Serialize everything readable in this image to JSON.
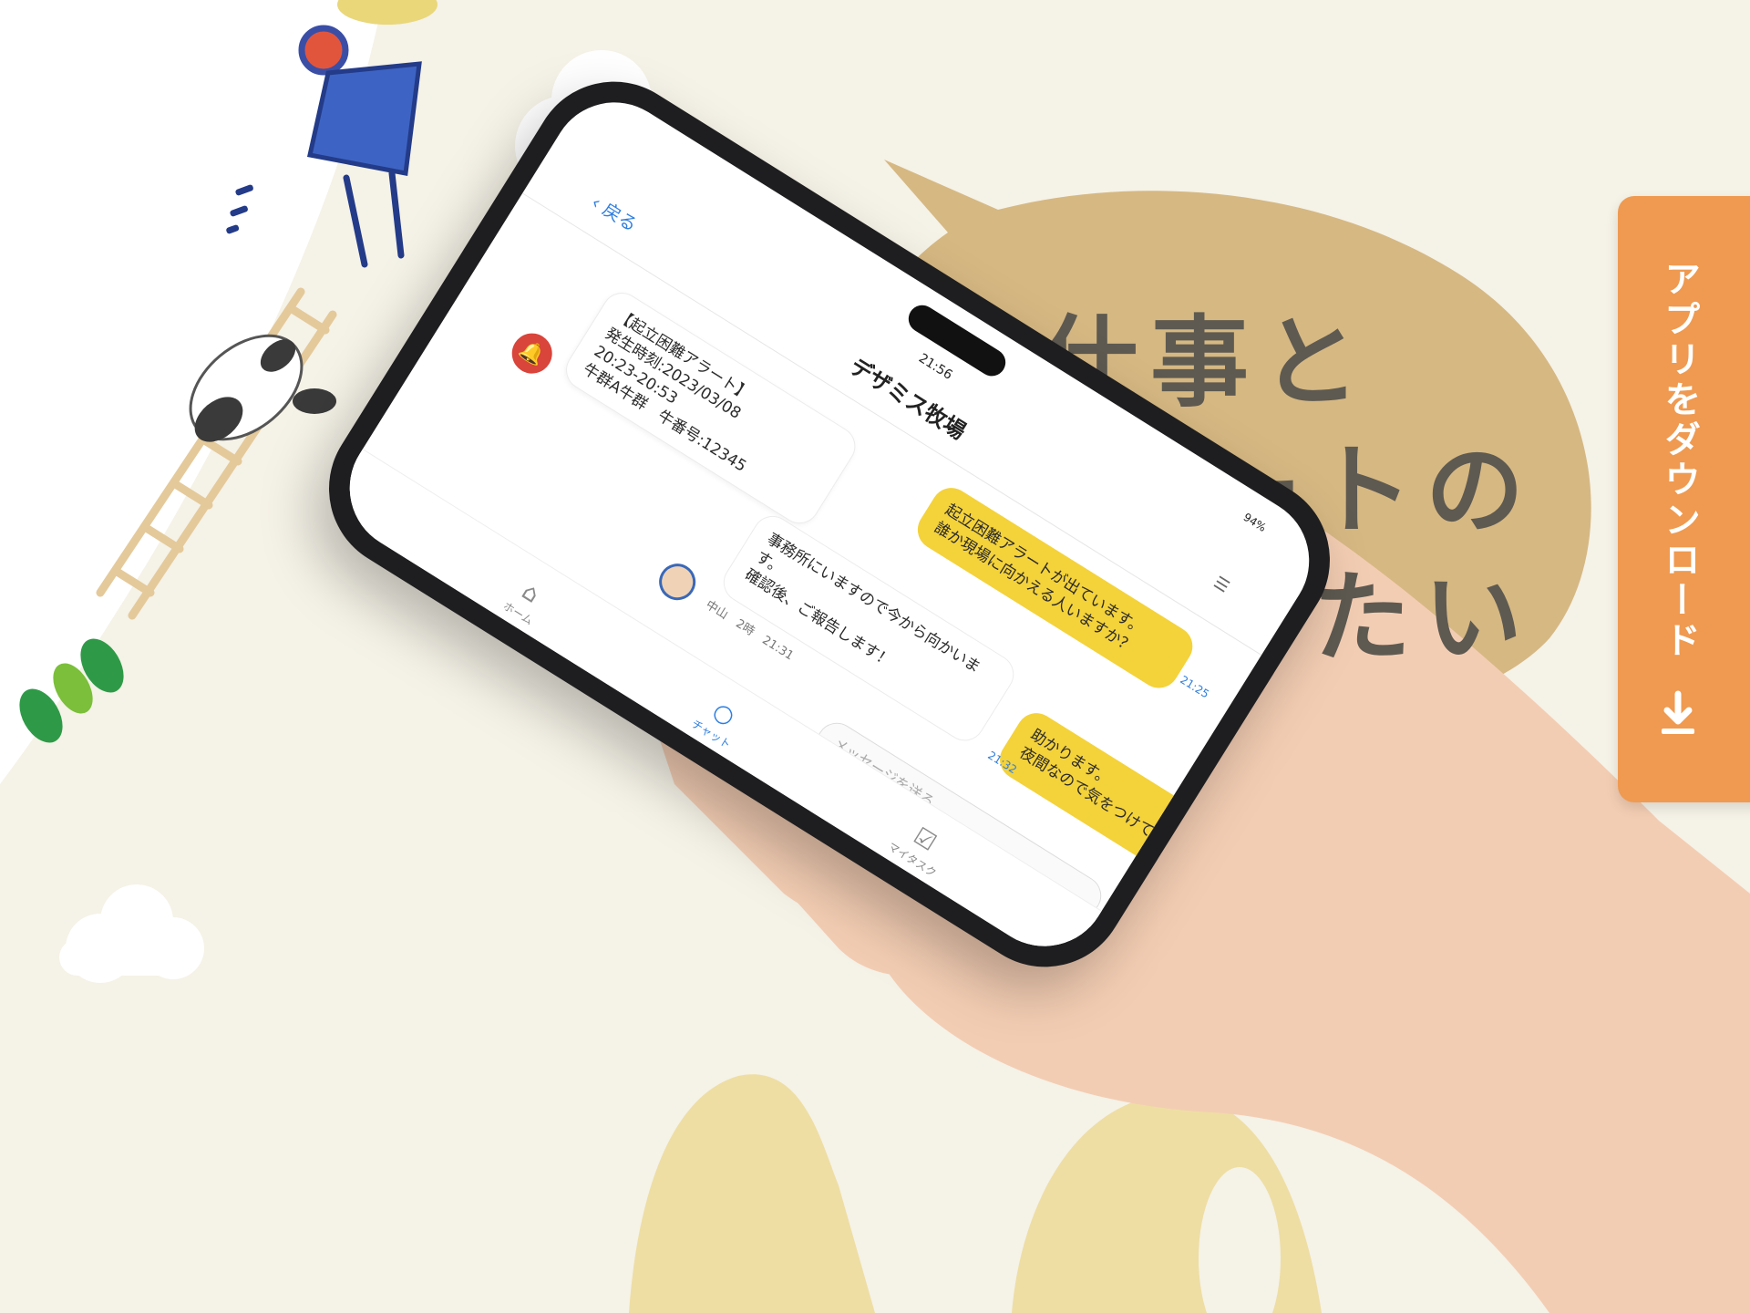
{
  "heading": {
    "line1": "仕事と",
    "line2": "ートの",
    "line3": "たい"
  },
  "download_tab": {
    "label": "アプリをダウンロード",
    "icon": "download-arrow-icon"
  },
  "phone": {
    "status_time": "21:56",
    "battery": "94%",
    "title": "デザミス牧場",
    "back_label": "戻る",
    "alert_message": {
      "line1": "【起立困難アラート】",
      "line2": "発生時刻:2023/03/08",
      "line3": "20:23-20:53",
      "line4": "牛群A牛群　牛番号:12345"
    },
    "outgoing_1": {
      "line1": "起立困難アラートが出ています。",
      "line2": "誰か現場に向かえる人いますか？",
      "time": "21:25"
    },
    "incoming": {
      "line1": "事務所にいますので今から向かいま",
      "line2": "す。",
      "line3": "確認後、ご報告します！",
      "sender": "中山　2時　21:31"
    },
    "outgoing_2": {
      "line1": "助かります。",
      "line2": "夜間なので気をつけて下さい！",
      "time": "21:32"
    },
    "input_placeholder": "メッセージを送る",
    "tabs": [
      {
        "label": "ホーム",
        "icon": "home-icon"
      },
      {
        "label": "チャット",
        "icon": "chat-icon"
      },
      {
        "label": "マイタスク",
        "icon": "checkbox-icon"
      }
    ]
  },
  "colors": {
    "background": "#f5f2e7",
    "speech_bubble": "#d6b883",
    "download_tab": "#ef9a50",
    "message_yellow": "#f4d23a",
    "heading_text": "#5e5a51"
  }
}
